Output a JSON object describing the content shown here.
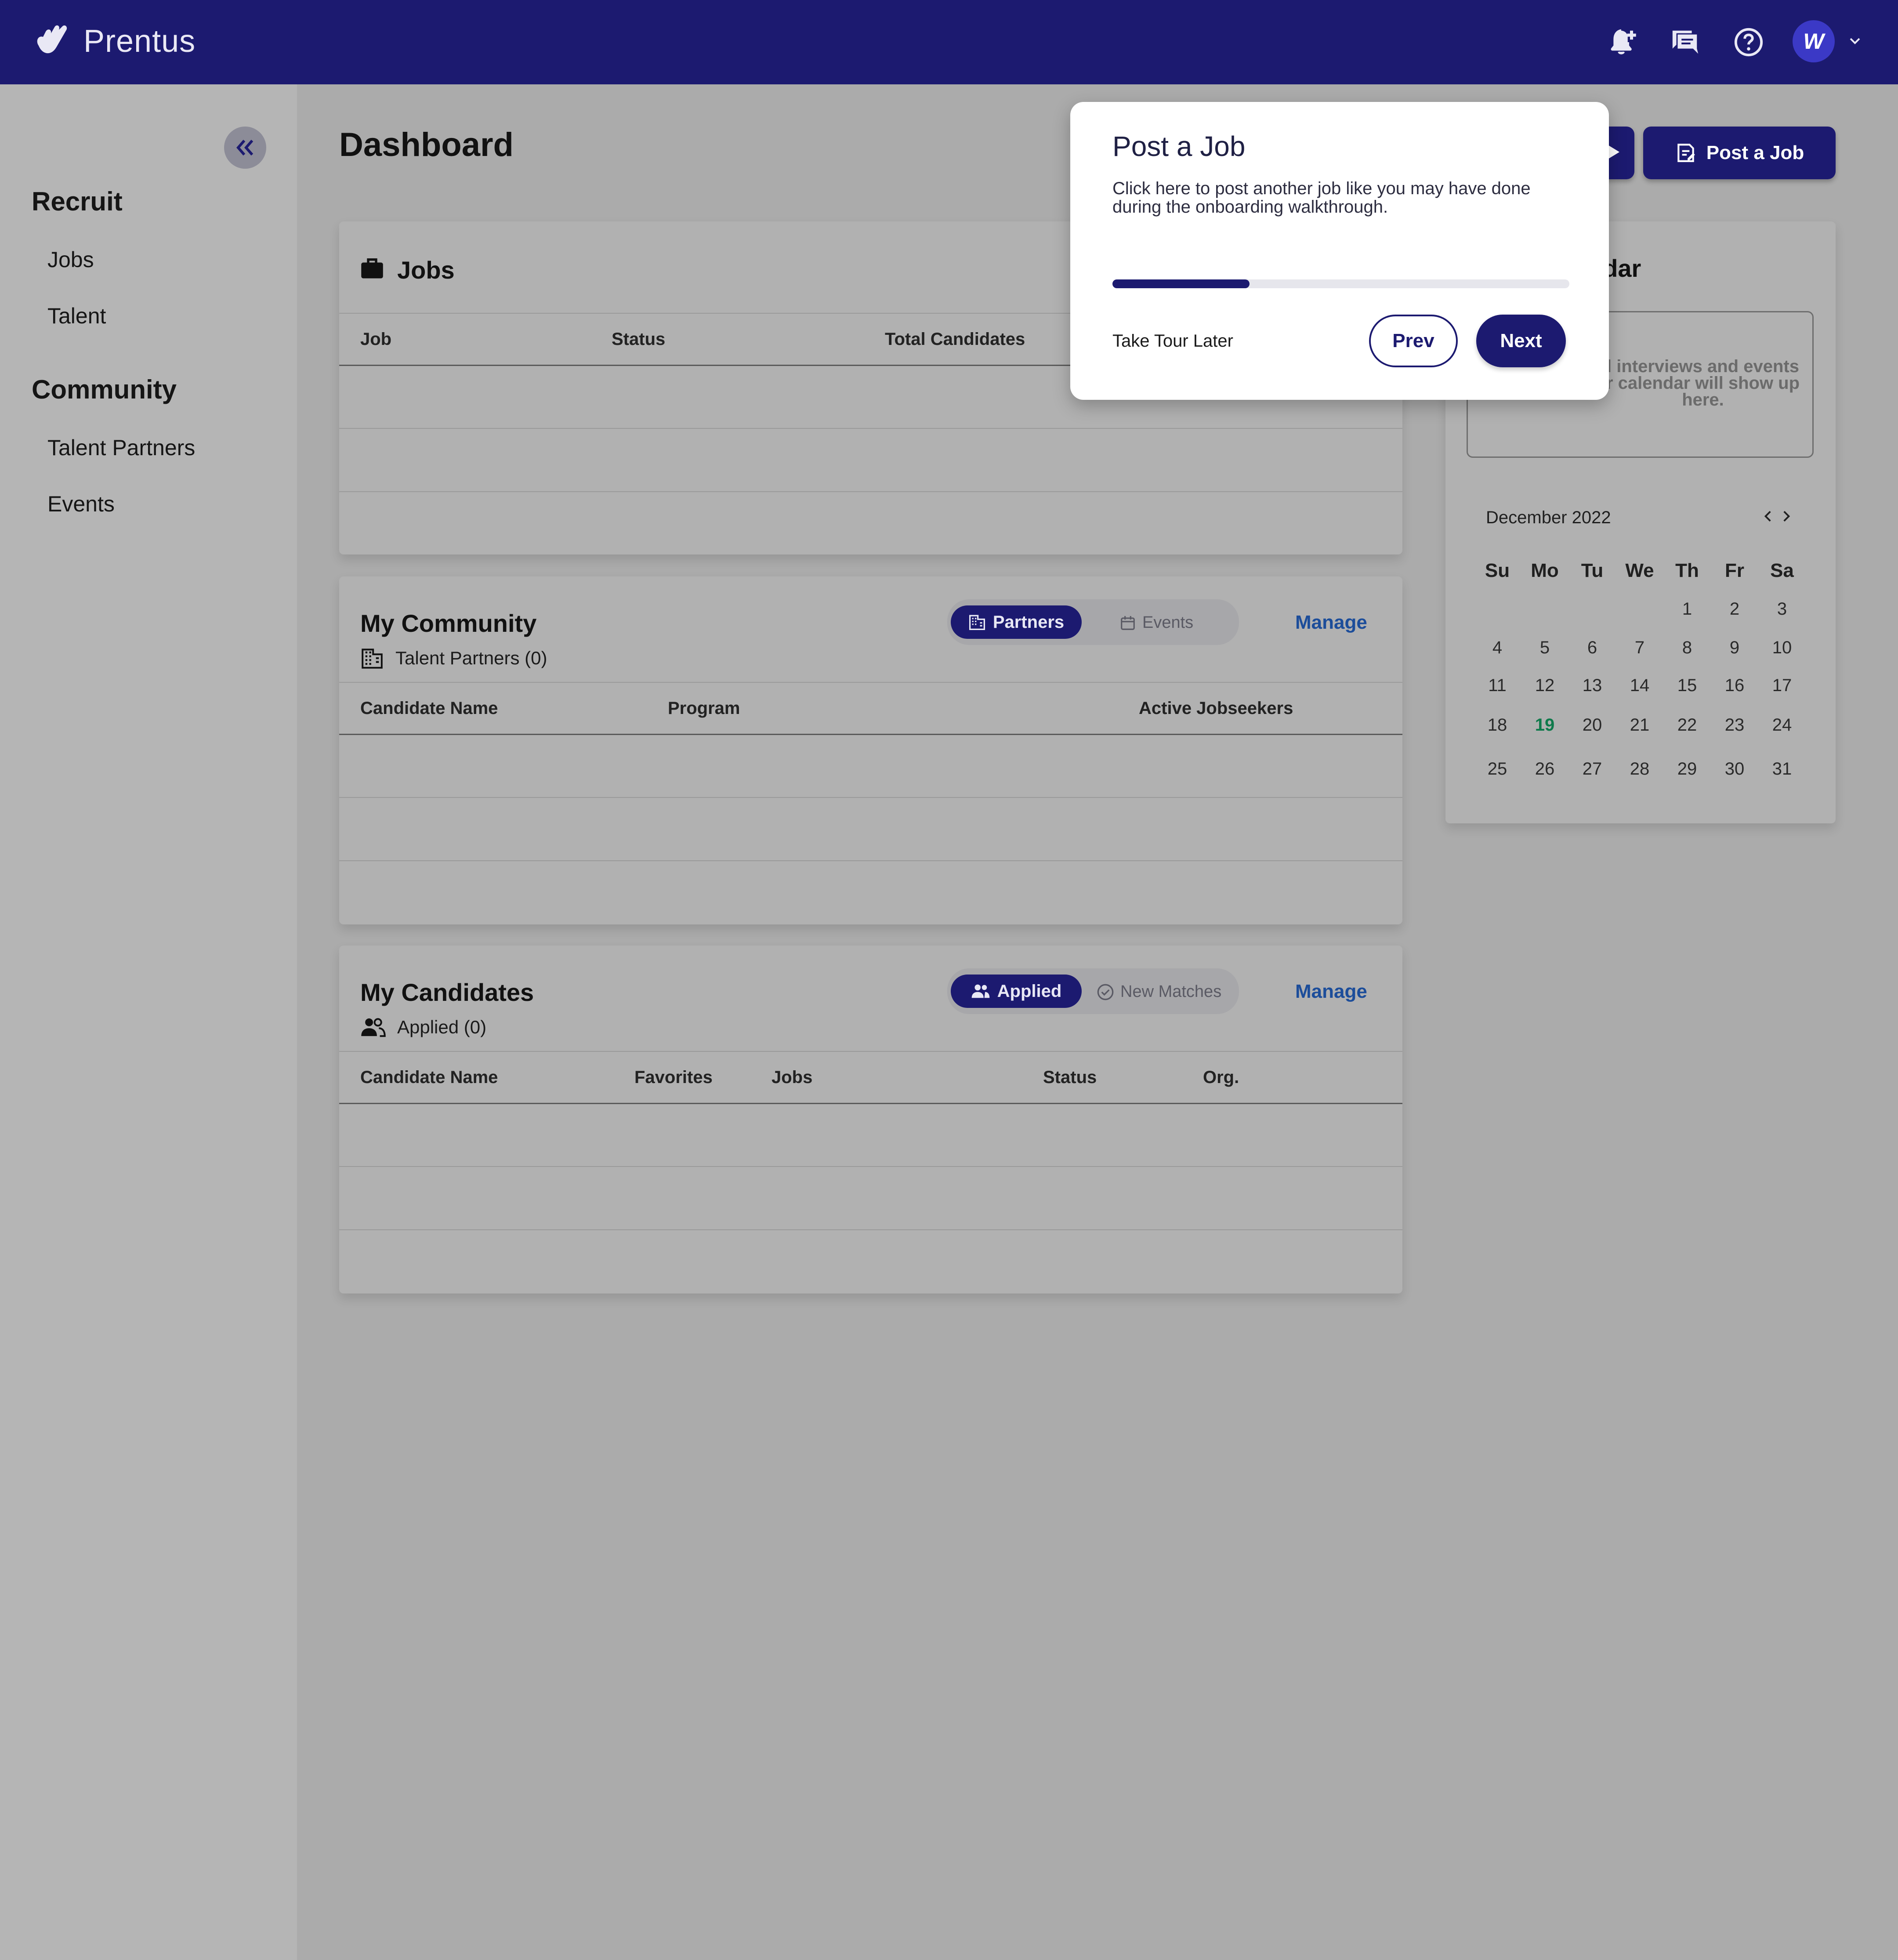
{
  "app": {
    "brand": "Prentus",
    "user_initial": "W"
  },
  "colors": {
    "navy": "#1c1a70",
    "link": "#1c4d9a",
    "today": "#0f7a4b"
  },
  "icons": [
    "hand-logo-icon",
    "bell-plus-icon",
    "chat-icon",
    "help-icon",
    "chevron-down-icon",
    "double-chevron-left-icon",
    "briefcase-icon",
    "building-icon",
    "calendar-icon",
    "people-icon",
    "check-circle-icon",
    "document-edit-icon",
    "chevron-left-icon",
    "chevron-right-icon"
  ],
  "sidebar": {
    "recruit_heading": "Recruit",
    "recruit_items": [
      "Jobs",
      "Talent"
    ],
    "community_heading": "Community",
    "community_items": [
      "Talent Partners",
      "Events"
    ]
  },
  "page": {
    "title": "Dashboard",
    "post_job_label": "Post a Job"
  },
  "jobs_card": {
    "title": "Jobs",
    "columns": [
      "Job",
      "Status",
      "Total Candidates"
    ]
  },
  "community_card": {
    "title": "My Community",
    "subtitle": "Talent Partners (0)",
    "tab_active": "Partners",
    "tab_inactive": "Events",
    "manage": "Manage",
    "columns": [
      "Candidate Name",
      "Program",
      "Active Jobseekers"
    ]
  },
  "candidates_card": {
    "title": "My Candidates",
    "subtitle": "Applied (0)",
    "tab_active": "Applied",
    "tab_inactive": "New Matches",
    "manage": "Manage",
    "columns": [
      "Candidate Name",
      "Favorites",
      "Jobs",
      "Status",
      "Org."
    ]
  },
  "calendar": {
    "title_partial": "ndar",
    "empty_text": [
      "l interviews and events",
      "r calendar will show up",
      "here."
    ],
    "month": "December 2022",
    "weekdays": [
      "Su",
      "Mo",
      "Tu",
      "We",
      "Th",
      "Fr",
      "Sa"
    ],
    "weeks": [
      [
        "",
        "",
        "",
        "",
        "1",
        "2",
        "3"
      ],
      [
        "4",
        "5",
        "6",
        "7",
        "8",
        "9",
        "10"
      ],
      [
        "11",
        "12",
        "13",
        "14",
        "15",
        "16",
        "17"
      ],
      [
        "18",
        "19",
        "20",
        "21",
        "22",
        "23",
        "24"
      ],
      [
        "25",
        "26",
        "27",
        "28",
        "29",
        "30",
        "31"
      ]
    ],
    "today": "19"
  },
  "tour": {
    "title": "Post a Job",
    "body": "Click here to post another job like you may have done during the onboarding walkthrough.",
    "progress": 0.3,
    "take_later": "Take Tour Later",
    "prev": "Prev",
    "next": "Next"
  }
}
